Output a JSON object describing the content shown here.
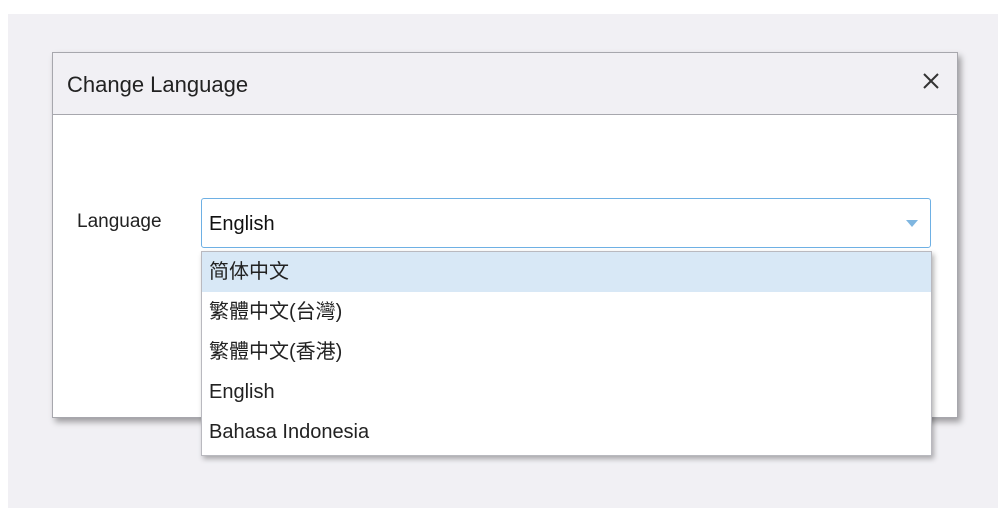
{
  "dialog": {
    "title": "Change Language",
    "close_icon": "close-icon"
  },
  "form": {
    "label": "Language",
    "selected": "English"
  },
  "dropdown": {
    "items": [
      {
        "label": "简体中文",
        "highlighted": true
      },
      {
        "label": "繁體中文(台灣)",
        "highlighted": false
      },
      {
        "label": "繁體中文(香港)",
        "highlighted": false
      },
      {
        "label": "English",
        "highlighted": false
      },
      {
        "label": "Bahasa Indonesia",
        "highlighted": false
      }
    ]
  },
  "colors": {
    "backdrop": "#f1f0f4",
    "header": "#f1f0f4",
    "select_border": "#6eb0e4",
    "highlight": "#d8e8f6"
  }
}
